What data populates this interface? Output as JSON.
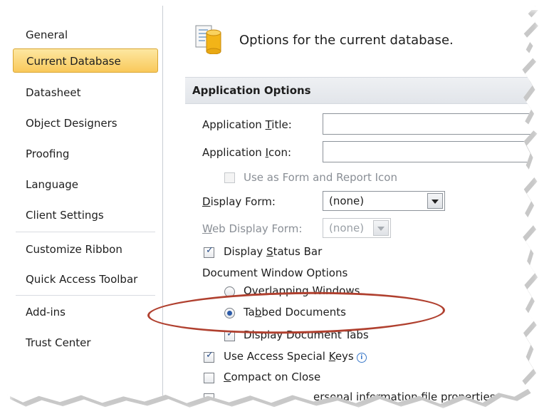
{
  "sidebar": {
    "items": [
      {
        "label": "General"
      },
      {
        "label": "Current Database"
      },
      {
        "label": "Datasheet"
      },
      {
        "label": "Object Designers"
      },
      {
        "label": "Proofing"
      },
      {
        "label": "Language"
      },
      {
        "label": "Client Settings"
      },
      {
        "label": "Customize Ribbon"
      },
      {
        "label": "Quick Access Toolbar"
      },
      {
        "label": "Add-ins"
      },
      {
        "label": "Trust Center"
      }
    ]
  },
  "header": {
    "title": "Options for the current database.",
    "icon": "database-icon"
  },
  "section": {
    "title": "Application Options"
  },
  "form": {
    "app_title_label_pre": "Application ",
    "app_title_label_u": "T",
    "app_title_label_post": "itle:",
    "app_title_value": "",
    "app_icon_label_pre": "Application ",
    "app_icon_label_u": "I",
    "app_icon_label_post": "con:",
    "app_icon_value": "",
    "use_as_icon_label": "Use as Form and Report Icon",
    "display_form_label_u": "D",
    "display_form_label_post": "isplay Form:",
    "display_form_value": "(none)",
    "web_display_form_label_u": "W",
    "web_display_form_label_post": "eb Display Form:",
    "web_display_form_value": "(none)",
    "status_bar_label_pre": "Display ",
    "status_bar_label_u": "S",
    "status_bar_label_post": "tatus Bar",
    "doc_window_label": "Document Window Options",
    "overlapping_label": "Overlapping Windows",
    "tabbed_label_pre": "Ta",
    "tabbed_label_u": "b",
    "tabbed_label_post": "bed Documents",
    "doc_tabs_label": "Display Document Tabs",
    "special_keys_label_pre": "Use Access Special ",
    "special_keys_label_u": "K",
    "special_keys_label_post": "eys",
    "compact_label_pre": "",
    "compact_label_u": "C",
    "compact_label_post": "ompact on Close",
    "remove_personal_label": "ersonal information file properties"
  },
  "colors": {
    "active_nav": "#f9c95b",
    "annotation": "#b0402f"
  }
}
